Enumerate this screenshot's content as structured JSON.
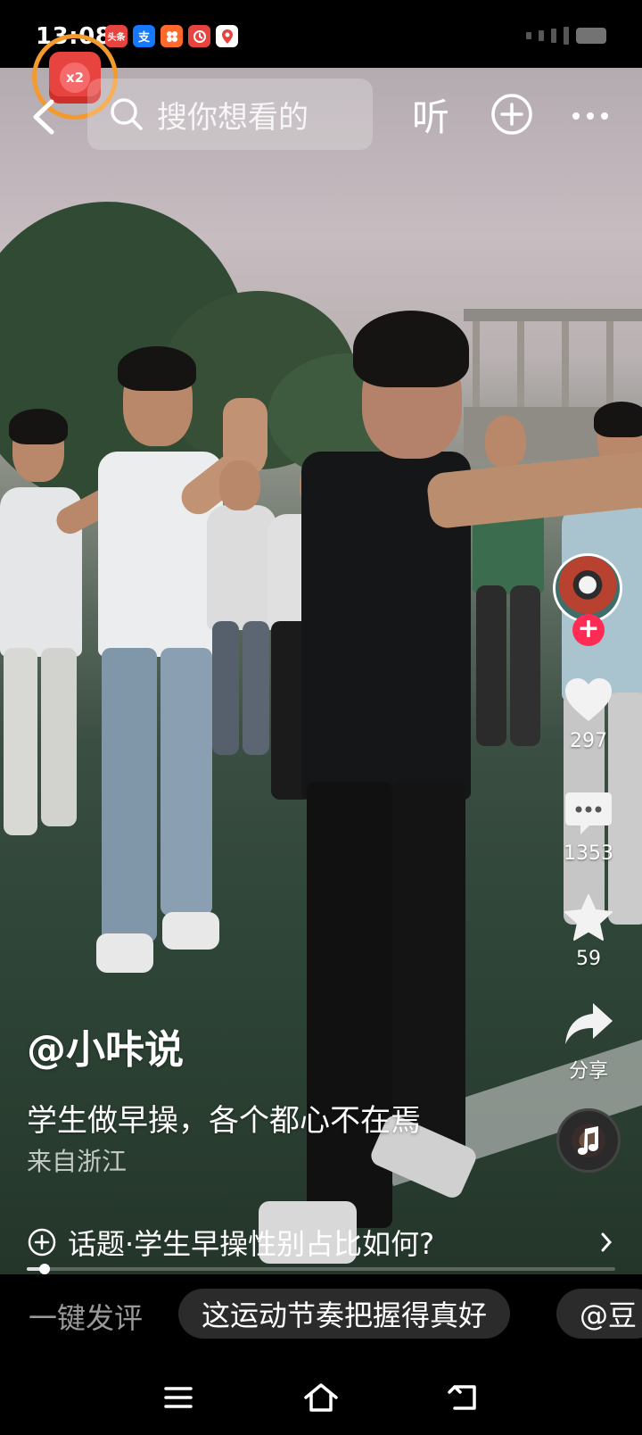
{
  "status_bar": {
    "time": "13:08",
    "app_icons": [
      {
        "name": "toutiao-icon",
        "label": "头条",
        "color": "#e8443f"
      },
      {
        "name": "alipay-icon",
        "label": "支",
        "color": "#1677ff"
      },
      {
        "name": "app-orange-icon",
        "label": "",
        "color": "#ff6a2c"
      },
      {
        "name": "app-red-icon",
        "label": "",
        "color": "#e8443f"
      },
      {
        "name": "map-icon",
        "label": "",
        "color": "#ffffff"
      }
    ]
  },
  "top_bar": {
    "redpack_badge": "x2",
    "search_placeholder": "搜你想看的",
    "listen_label": "听"
  },
  "rail": {
    "likes": "297",
    "comments": "1353",
    "favorites": "59",
    "share_label": "分享"
  },
  "post": {
    "author": "@小咔说",
    "caption": "学生做早操，各个都心不在焉",
    "location": "来自浙江",
    "topic": "话题·学生早操性别占比如何?",
    "progress": 0.03
  },
  "comment_bar": {
    "quick_label": "一键发评",
    "chips": [
      "这运动节奏把握得真好",
      "@豆"
    ]
  },
  "colors": {
    "accent_red": "#fe2c55",
    "ring_orange": "#f39a2c"
  }
}
